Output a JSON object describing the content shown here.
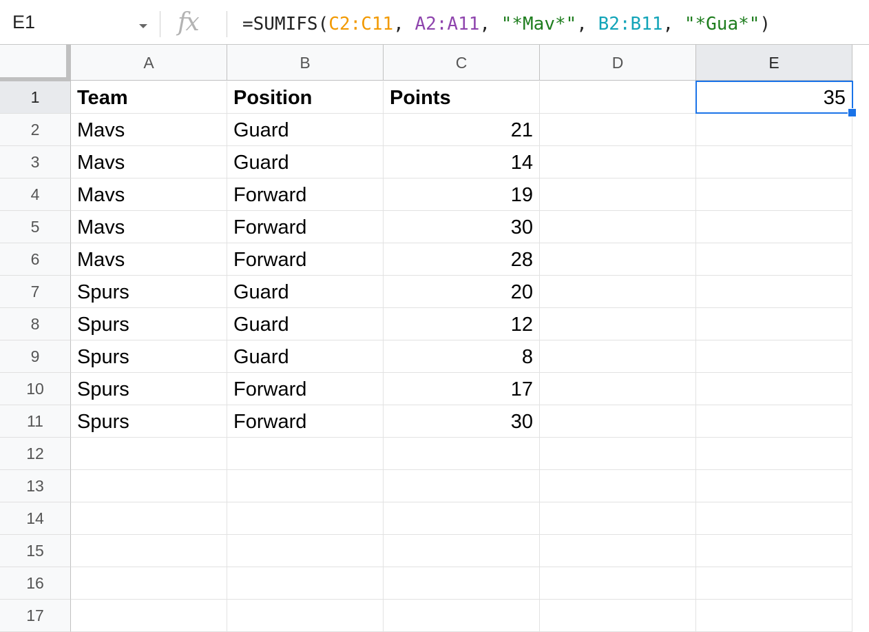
{
  "formula_bar": {
    "name_box": "E1",
    "fx_label": "fx",
    "formula_parts": [
      {
        "text": "=SUMIFS(",
        "color": "#222222"
      },
      {
        "text": "C2:C11",
        "color": "#f29900"
      },
      {
        "text": ", ",
        "color": "#222222"
      },
      {
        "text": "A2:A11",
        "color": "#8e44ad"
      },
      {
        "text": ", ",
        "color": "#222222"
      },
      {
        "text": "\"*Mav*\"",
        "color": "#1e7d1e"
      },
      {
        "text": ", ",
        "color": "#222222"
      },
      {
        "text": "B2:B11",
        "color": "#12a4b8"
      },
      {
        "text": ", ",
        "color": "#222222"
      },
      {
        "text": "\"*Gua*\"",
        "color": "#1e7d1e"
      },
      {
        "text": ")",
        "color": "#222222"
      }
    ]
  },
  "columns": [
    "A",
    "B",
    "C",
    "D",
    "E"
  ],
  "selected_column": "E",
  "row_numbers": [
    "1",
    "2",
    "3",
    "4",
    "5",
    "6",
    "7",
    "8",
    "9",
    "10",
    "11",
    "12",
    "13",
    "14",
    "15",
    "16",
    "17"
  ],
  "selected_row": "1",
  "cells": {
    "headers": [
      "Team",
      "Position",
      "Points"
    ],
    "rows": [
      [
        "Mavs",
        "Guard",
        "21"
      ],
      [
        "Mavs",
        "Guard",
        "14"
      ],
      [
        "Mavs",
        "Forward",
        "19"
      ],
      [
        "Mavs",
        "Forward",
        "30"
      ],
      [
        "Mavs",
        "Forward",
        "28"
      ],
      [
        "Spurs",
        "Guard",
        "20"
      ],
      [
        "Spurs",
        "Guard",
        "12"
      ],
      [
        "Spurs",
        "Guard",
        "8"
      ],
      [
        "Spurs",
        "Forward",
        "17"
      ],
      [
        "Spurs",
        "Forward",
        "30"
      ]
    ],
    "e1_value": "35"
  },
  "colors": {
    "selection": "#1a73e8",
    "header_bg": "#f8f9fa",
    "selected_header_bg": "#e8eaed"
  }
}
